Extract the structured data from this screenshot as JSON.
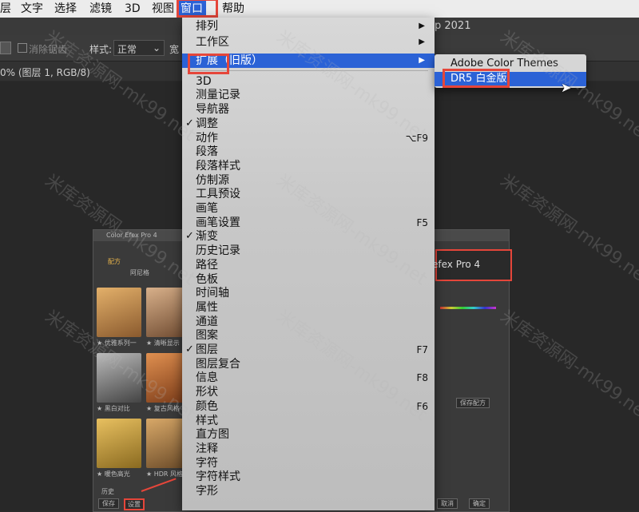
{
  "menubar": {
    "items": [
      "层",
      "文字",
      "选择",
      "滤镜",
      "3D",
      "视图",
      "窗口",
      "帮助"
    ],
    "active_index": 6
  },
  "titlebar": {
    "text": "p 2021"
  },
  "optionsbar": {
    "antialias": "消除锯齿",
    "style_label": "样式:",
    "style_value": "正常",
    "width_label": "宽"
  },
  "document_tab": {
    "label": "0% (图层 1, RGB/8)"
  },
  "window_menu": {
    "items": [
      {
        "label": "排列",
        "submenu": true
      },
      {
        "label": "工作区",
        "submenu": true
      },
      {
        "label": "扩展（旧版）",
        "submenu": true,
        "selected": true
      },
      {
        "label": "3D"
      },
      {
        "label": "测量记录"
      },
      {
        "label": "导航器"
      },
      {
        "label": "调整",
        "checked": true
      },
      {
        "label": "动作",
        "shortcut": "⌥F9"
      },
      {
        "label": "段落"
      },
      {
        "label": "段落样式"
      },
      {
        "label": "仿制源"
      },
      {
        "label": "工具预设"
      },
      {
        "label": "画笔"
      },
      {
        "label": "画笔设置",
        "shortcut": "F5"
      },
      {
        "label": "渐变",
        "checked": true
      },
      {
        "label": "历史记录"
      },
      {
        "label": "路径"
      },
      {
        "label": "色板"
      },
      {
        "label": "时间轴"
      },
      {
        "label": "属性"
      },
      {
        "label": "通道"
      },
      {
        "label": "图案"
      },
      {
        "label": "图层",
        "checked": true,
        "shortcut": "F7"
      },
      {
        "label": "图层复合"
      },
      {
        "label": "信息",
        "shortcut": "F8"
      },
      {
        "label": "形状"
      },
      {
        "label": "颜色",
        "shortcut": "F6"
      },
      {
        "label": "样式"
      },
      {
        "label": "直方图"
      },
      {
        "label": "注释"
      },
      {
        "label": "字符"
      },
      {
        "label": "字符样式"
      },
      {
        "label": "字形"
      }
    ]
  },
  "extensions_submenu": {
    "items": [
      {
        "label": "Adobe Color Themes"
      },
      {
        "label": "DR5 白金版",
        "selected": true
      }
    ]
  },
  "plugin_window": {
    "title": "Color Efex Pro 4",
    "header_text": "efex Pro 4",
    "tab_label": "配方",
    "section_label": "阿尼格",
    "thumb_captions": [
      "★ 优雅系列一",
      "★ 清晰显示",
      "★ 黑白对比",
      "★ 复古风格",
      "★ 暖色高光",
      "★ HDR 风格"
    ],
    "bottom_buttons": [
      "保存",
      "设置"
    ],
    "history_label": "历史",
    "ok_label": "确定",
    "cancel_label": "取消",
    "save_recipe_label": "保存配方"
  },
  "watermark": "米库资源网-mk99.net"
}
